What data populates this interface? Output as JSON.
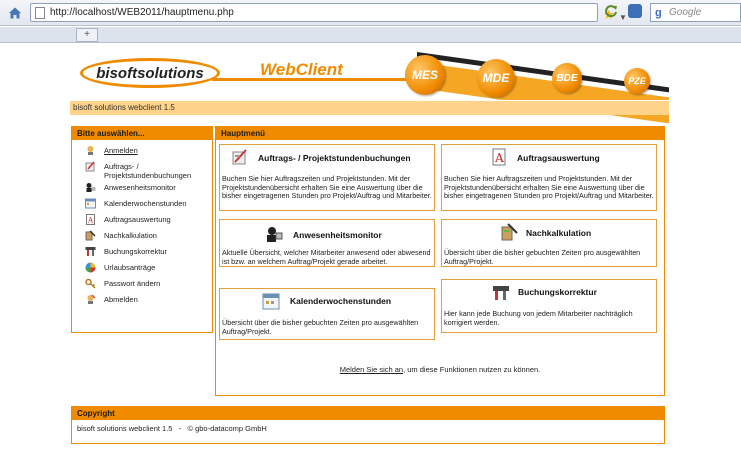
{
  "browser": {
    "url": "http://localhost/WEB2011/hauptmenu.php",
    "search_placeholder": "Google",
    "search_brand": "g",
    "new_tab_label": "+"
  },
  "header": {
    "logo_text": "bisoftsolutions",
    "product_text": "WebClient",
    "balls": [
      "MES",
      "MDE",
      "BDE",
      "PZE"
    ],
    "accent_color": "#f08b00"
  },
  "title_strip": "bisoft solutions webclient 1.5",
  "sidebar": {
    "title": "Bitte auswählen...",
    "items": [
      {
        "label": "Anmelden",
        "icon": "login-icon"
      },
      {
        "label": "Auftrags- / Projektstundenbuchungen",
        "icon": "booking-icon"
      },
      {
        "label": "Anwesenheitsmonitor",
        "icon": "presence-icon"
      },
      {
        "label": "Kalenderwochenstunden",
        "icon": "calendar-icon"
      },
      {
        "label": "Auftragsauswertung",
        "icon": "report-icon"
      },
      {
        "label": "Nachkalkulation",
        "icon": "calculation-icon"
      },
      {
        "label": "Buchungskorrektur",
        "icon": "correction-icon"
      },
      {
        "label": "Urlaubsanträge",
        "icon": "vacation-icon"
      },
      {
        "label": "Passwort ändern",
        "icon": "key-icon"
      },
      {
        "label": "Abmelden",
        "icon": "logout-icon"
      }
    ]
  },
  "main": {
    "title": "Hauptmenü",
    "cards": [
      {
        "title": "Auftrags- / Projektstundenbuchungen",
        "desc": "Buchen Sie hier Auftragszeiten und Projektstunden. Mit der Projektstundenübersicht erhalten Sie eine Auswertung über die bisher eingetragenen Stunden pro Projekt/Auftrag und Mitarbeiter."
      },
      {
        "title": "Auftragsauswertung",
        "desc": "Buchen Sie hier Auftragszeiten und Projektstunden. Mit der Projektstundenübersicht erhalten Sie eine Auswertung über die bisher eingetragenen Stunden pro Projekt/Auftrag und Mitarbeiter."
      },
      {
        "title": "Anwesenheitsmonitor",
        "desc": "Aktuelle Übersicht, welcher Mitarbeiter anwesend oder abwesend ist bzw. an welchem Auftrag/Projekt gerade arbeitet."
      },
      {
        "title": "Nachkalkulation",
        "desc": "Übersicht über die bisher gebuchten Zeiten pro ausgewählten Auftrag/Projekt."
      },
      {
        "title": "Kalenderwochenstunden",
        "desc": "Übersicht über die bisher gebuchten Zeiten pro ausgewählten Auftrag/Projekt."
      },
      {
        "title": "Buchungskorrektur",
        "desc": "Hier kann jede Buchung von jedem Mitarbeiter nachträglich korrigiert werden."
      }
    ],
    "login_link": "Melden Sie sich an",
    "login_rest": ", um diese Funktionen nutzen zu können."
  },
  "footer": {
    "title": "Copyright",
    "text": "bisoft solutions webclient 1.5   -   © gbo-datacomp GmbH"
  }
}
